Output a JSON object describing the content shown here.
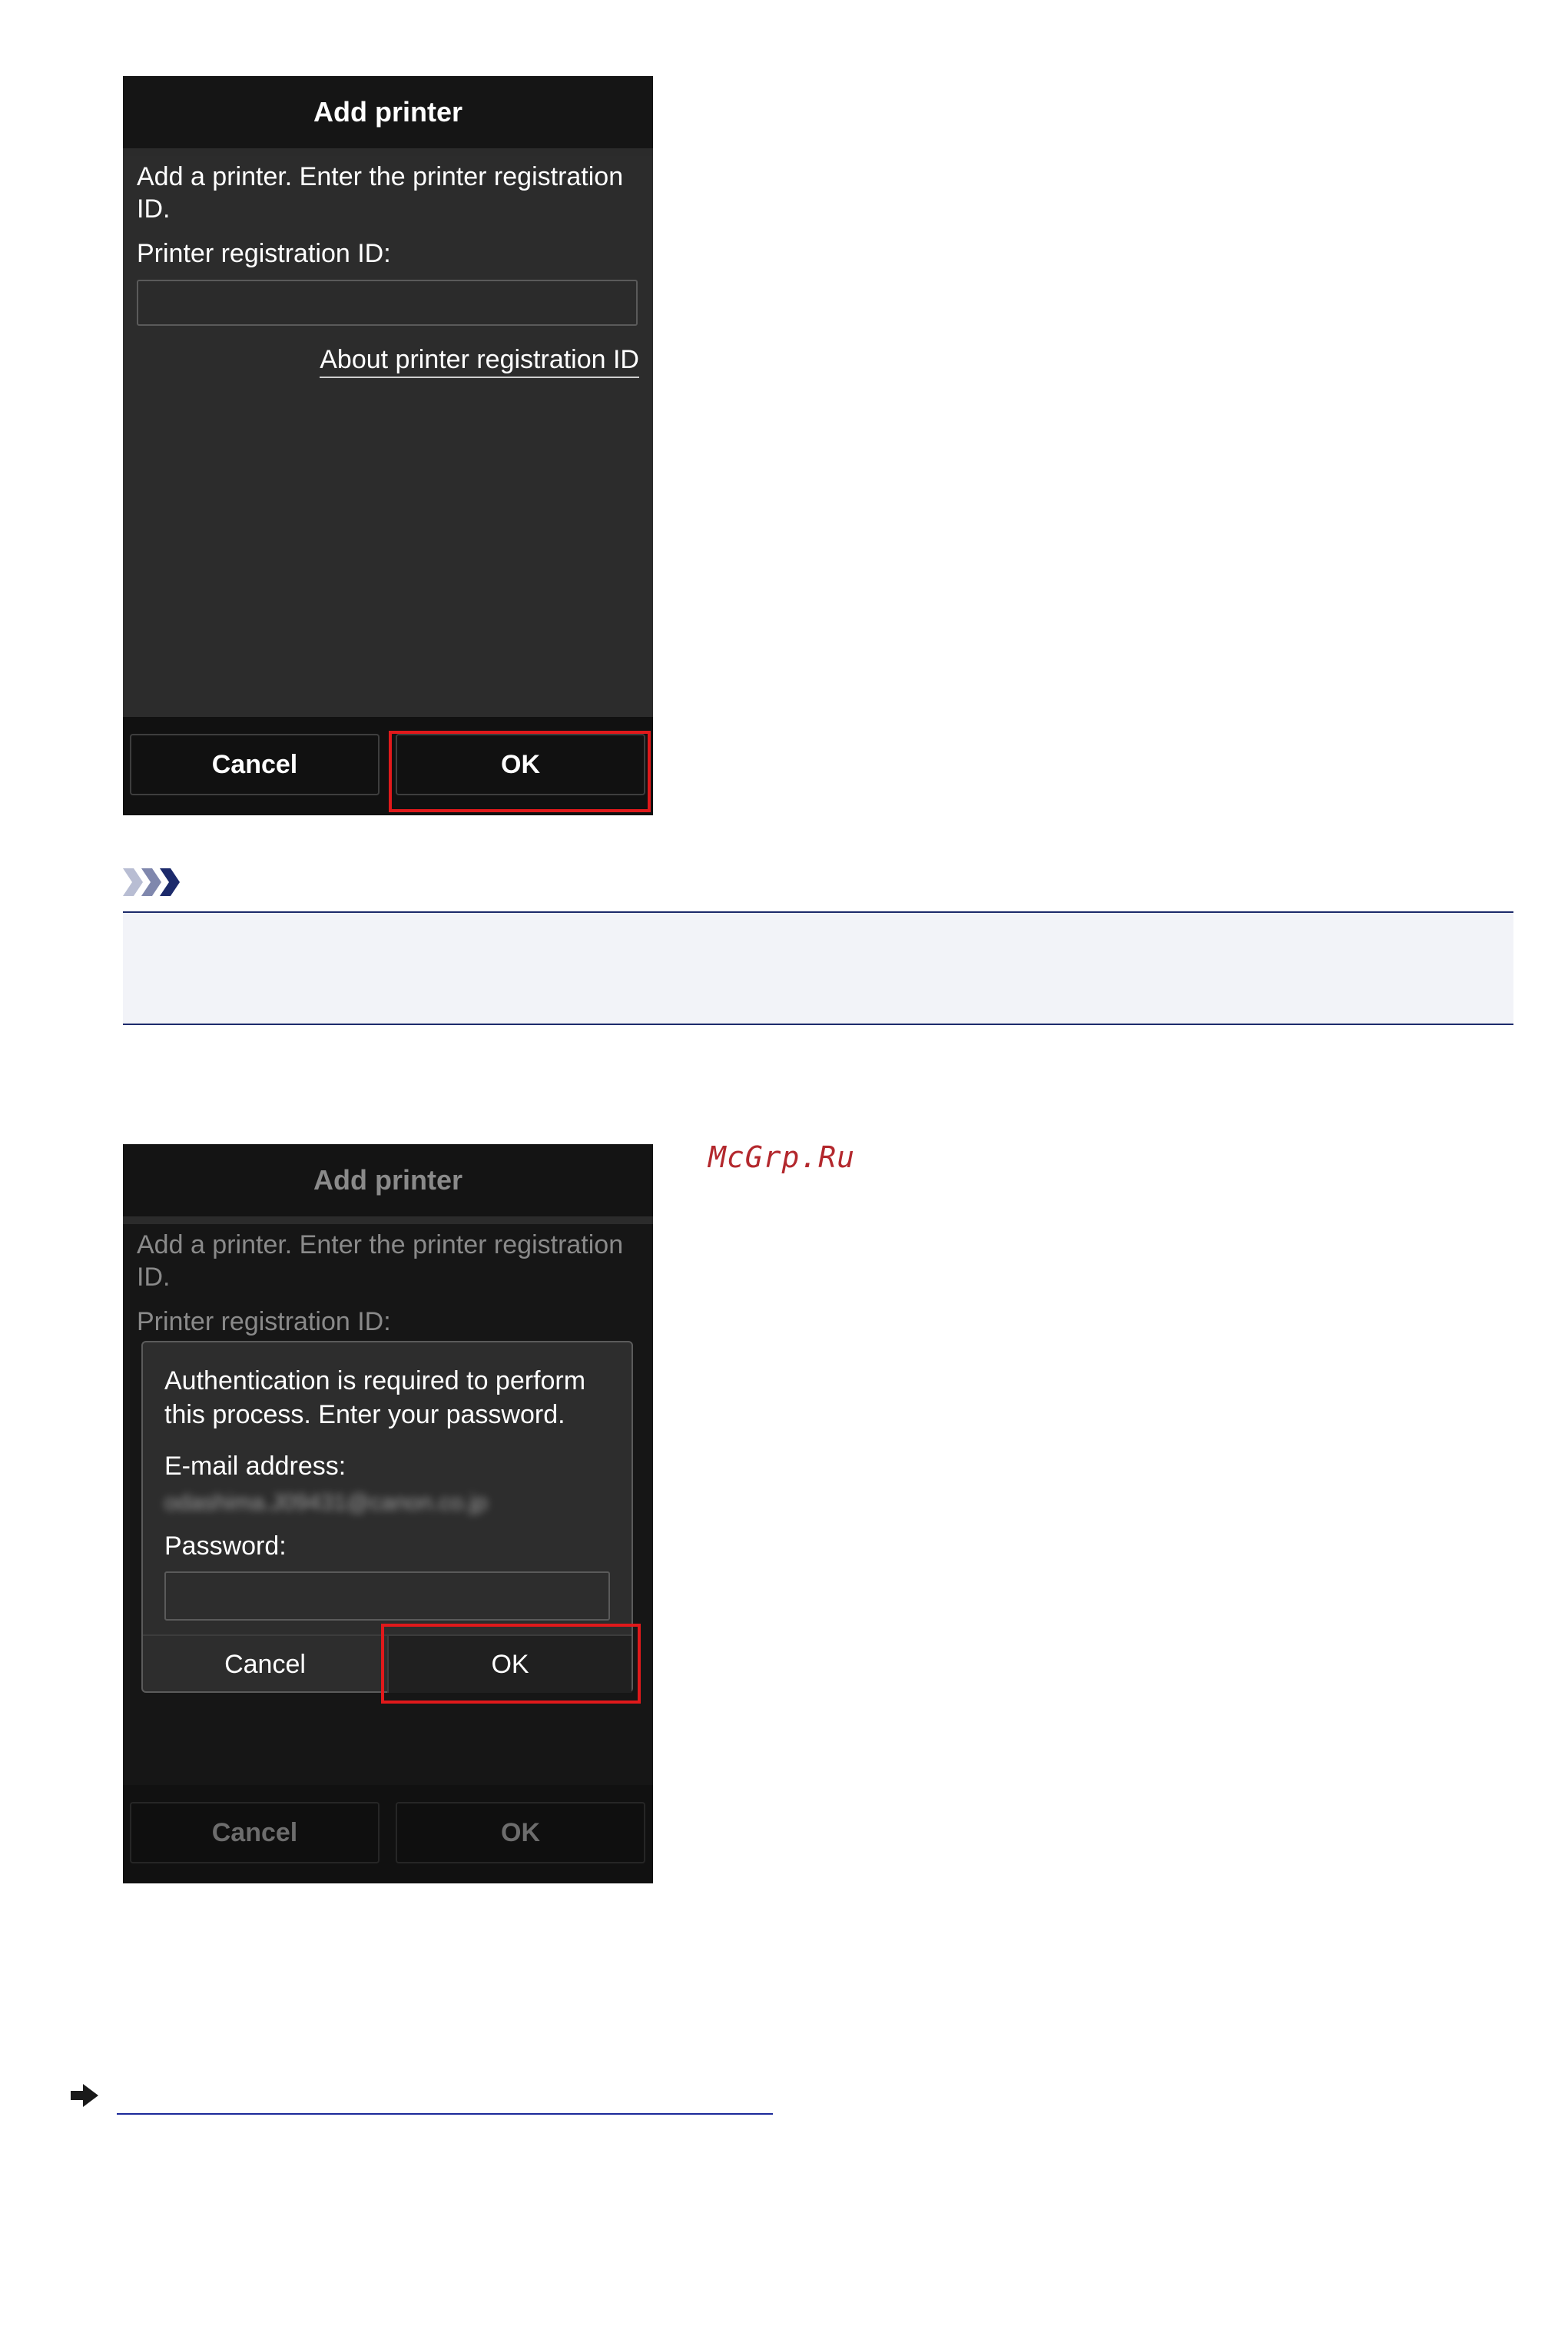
{
  "screen1": {
    "title": "Add printer",
    "message": "Add a printer. Enter the printer registration ID.",
    "field_label": "Printer registration ID:",
    "field_value": "",
    "link": "About printer registration ID",
    "cancel": "Cancel",
    "ok": "OK"
  },
  "screen2": {
    "title": "Add printer",
    "message": "Add a printer. Enter the printer registration ID.",
    "field_label": "Printer registration ID:",
    "cancel": "Cancel",
    "ok": "OK",
    "dialog": {
      "message": "Authentication is required to perform this process. Enter your password.",
      "email_label": "E-mail address:",
      "email_value": "odashima.J09431@canon.co.jp",
      "password_label": "Password:",
      "password_value": "",
      "cancel": "Cancel",
      "ok": "OK"
    }
  },
  "watermark": "McGrp.Ru",
  "colors": {
    "highlight": "#e0191b",
    "note_rule": "#1c2a6b",
    "note_bg": "#f2f3f8",
    "watermark": "#b3282d"
  },
  "icons": {
    "note": "note-chevrons-icon",
    "link": "arrow-right-icon"
  }
}
